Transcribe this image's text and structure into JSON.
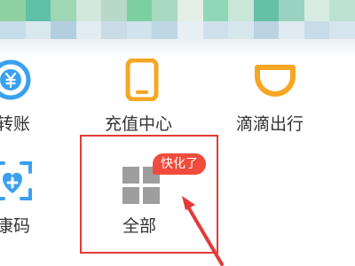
{
  "header": {
    "mosaic_colors": [
      "#8fd0a0",
      "#5fc0a8",
      "#9fd6b6",
      "#d2e8dc",
      "#b8d8c8",
      "#7ccfa0",
      "#a6d9c0",
      "#e6efe6",
      "#8fd7b7",
      "#c9e6d8",
      "#66c0a6",
      "#9ad2c1",
      "#d6ece3",
      "#bce1d2",
      "#c5dde8",
      "#d9e7ef",
      "#b3cfde",
      "#e0ecf2",
      "#cadbe6",
      "#d1e3ec",
      "#bfd6e3",
      "#e5eff4",
      "#cfe0ea",
      "#d8e6ee",
      "#bcd4e1",
      "#dfeaf1",
      "#c8dce7",
      "#d6e5ed"
    ]
  },
  "grid": {
    "items": [
      {
        "label": "转账",
        "icon": "yuan-transfer-icon"
      },
      {
        "label": "充值中心",
        "icon": "phone-recharge-icon"
      },
      {
        "label": "滴滴出行",
        "icon": "didi-icon"
      },
      {
        "label": "康码",
        "icon": "health-code-icon"
      },
      {
        "label": "全部",
        "icon": "grid-all-icon"
      }
    ]
  },
  "annotation": {
    "badge_text": "快化了",
    "box_color": "#e53935"
  },
  "colors": {
    "blue": "#3aa0f0",
    "orange": "#f5a623",
    "text": "#333333"
  }
}
